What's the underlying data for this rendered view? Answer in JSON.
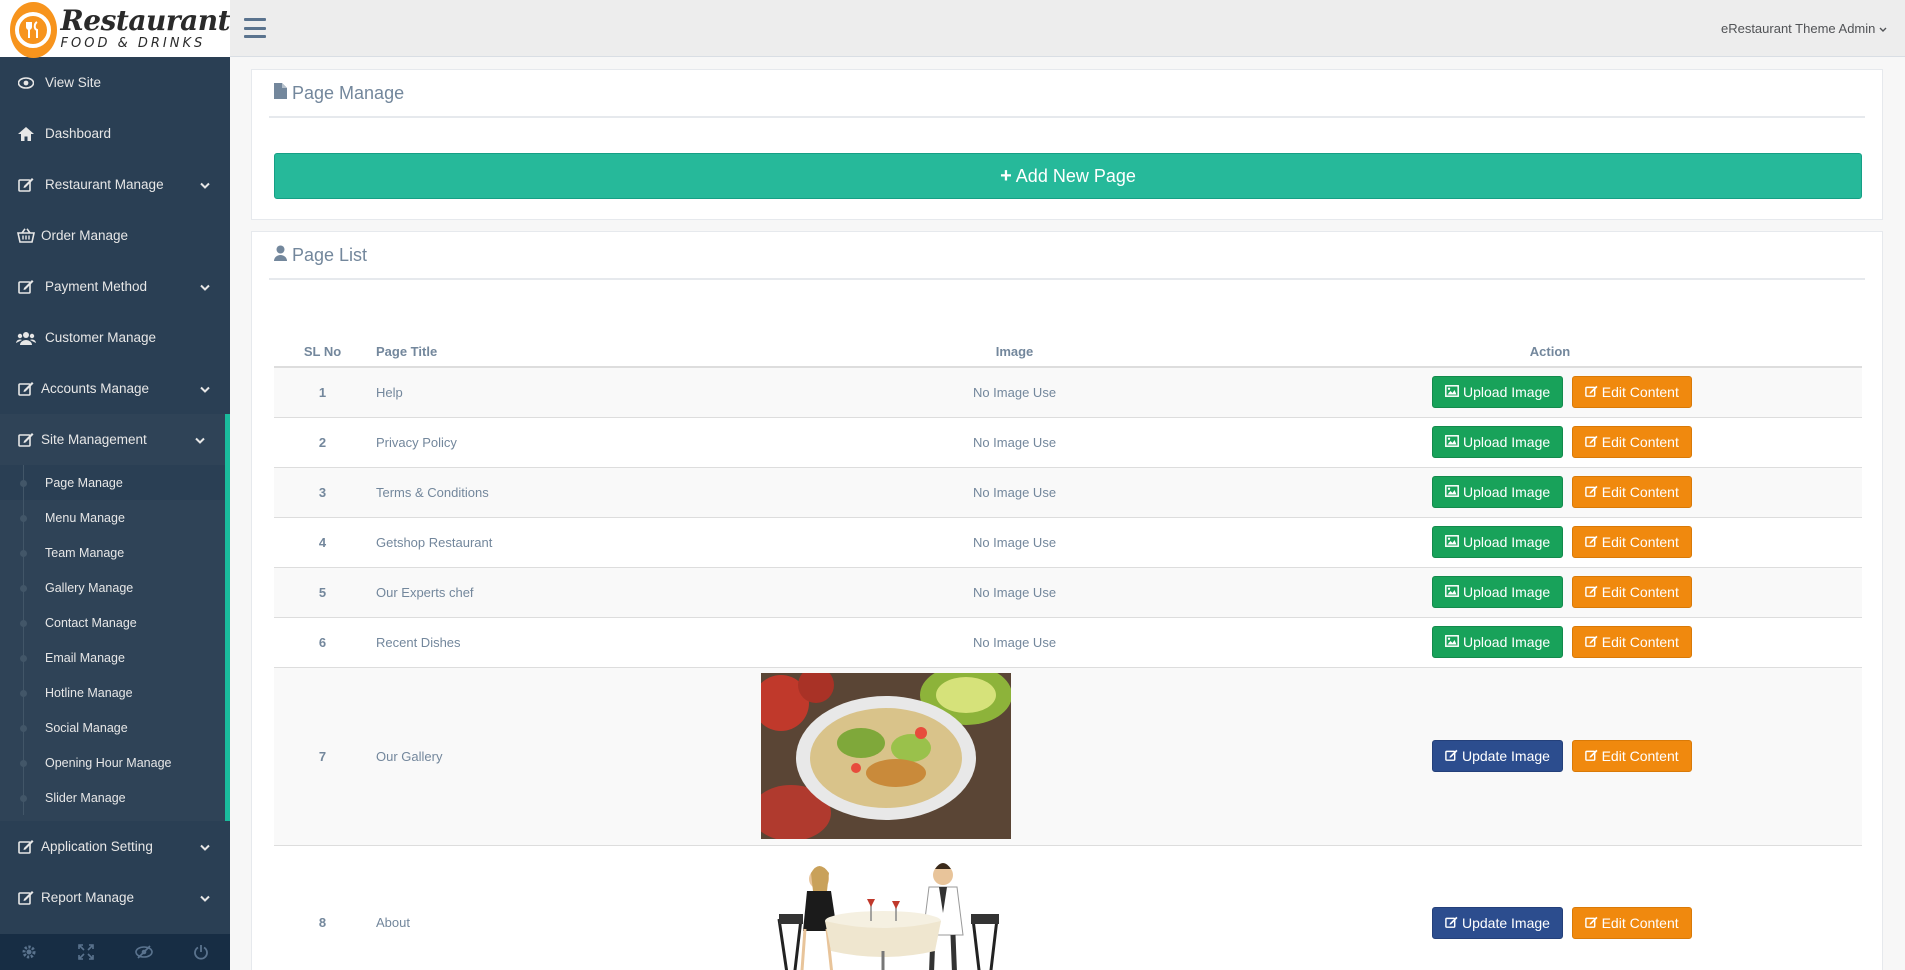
{
  "brand": {
    "title": "Restaurant",
    "subtitle": "FOOD & DRINKS"
  },
  "topbar": {
    "user": "eRestaurant Theme Admin"
  },
  "sidebar": {
    "items": [
      {
        "label": "View Site",
        "icon": "eye-icon",
        "has_children": false
      },
      {
        "label": "Dashboard",
        "icon": "home-icon",
        "has_children": false
      },
      {
        "label": "Restaurant Manage",
        "icon": "edit-icon",
        "has_children": true
      },
      {
        "label": "Order Manage",
        "icon": "basket-icon",
        "has_children": false
      },
      {
        "label": "Payment Method",
        "icon": "edit-icon",
        "has_children": true
      },
      {
        "label": "Customer Manage",
        "icon": "users-icon",
        "has_children": false
      },
      {
        "label": "Accounts Manage",
        "icon": "edit-icon",
        "has_children": true
      },
      {
        "label": "Site Management",
        "icon": "edit-icon",
        "has_children": true
      }
    ],
    "site_management_children": [
      "Page Manage",
      "Menu Manage",
      "Team Manage",
      "Gallery Manage",
      "Contact Manage",
      "Email Manage",
      "Hotline Manage",
      "Social Manage",
      "Opening Hour Manage",
      "Slider Manage"
    ],
    "bottom_items": [
      {
        "label": "Application Setting",
        "icon": "edit-icon"
      },
      {
        "label": "Report Manage",
        "icon": "edit-icon"
      }
    ],
    "footer_icons": [
      "gear-icon",
      "fullscreen-icon",
      "eye-slash-icon",
      "power-icon"
    ]
  },
  "page_manage": {
    "title": "Page Manage",
    "add_button": "Add New Page"
  },
  "page_list": {
    "title": "Page List",
    "headers": {
      "sl": "SL No",
      "title": "Page Title",
      "image": "Image",
      "action": "Action"
    },
    "upload_label": "Upload Image",
    "update_label": "Update Image",
    "edit_label": "Edit Content",
    "rows": [
      {
        "sl": "1",
        "title": "Help",
        "image": "No Image Use"
      },
      {
        "sl": "2",
        "title": "Privacy Policy",
        "image": "No Image Use"
      },
      {
        "sl": "3",
        "title": "Terms & Conditions",
        "image": "No Image Use"
      },
      {
        "sl": "4",
        "title": "Getshop Restaurant",
        "image": "No Image Use"
      },
      {
        "sl": "5",
        "title": "Our Experts chef",
        "image": "No Image Use"
      },
      {
        "sl": "6",
        "title": "Recent Dishes",
        "image": "No Image Use"
      },
      {
        "sl": "7",
        "title": "Our Gallery",
        "image": ""
      },
      {
        "sl": "8",
        "title": "About",
        "image": ""
      }
    ]
  },
  "colors": {
    "sidebar": "#2a3f54",
    "accent": "#1abb9c",
    "green": "#26b99a",
    "orange": "#f0890e",
    "blue": "#2c4d8e"
  }
}
